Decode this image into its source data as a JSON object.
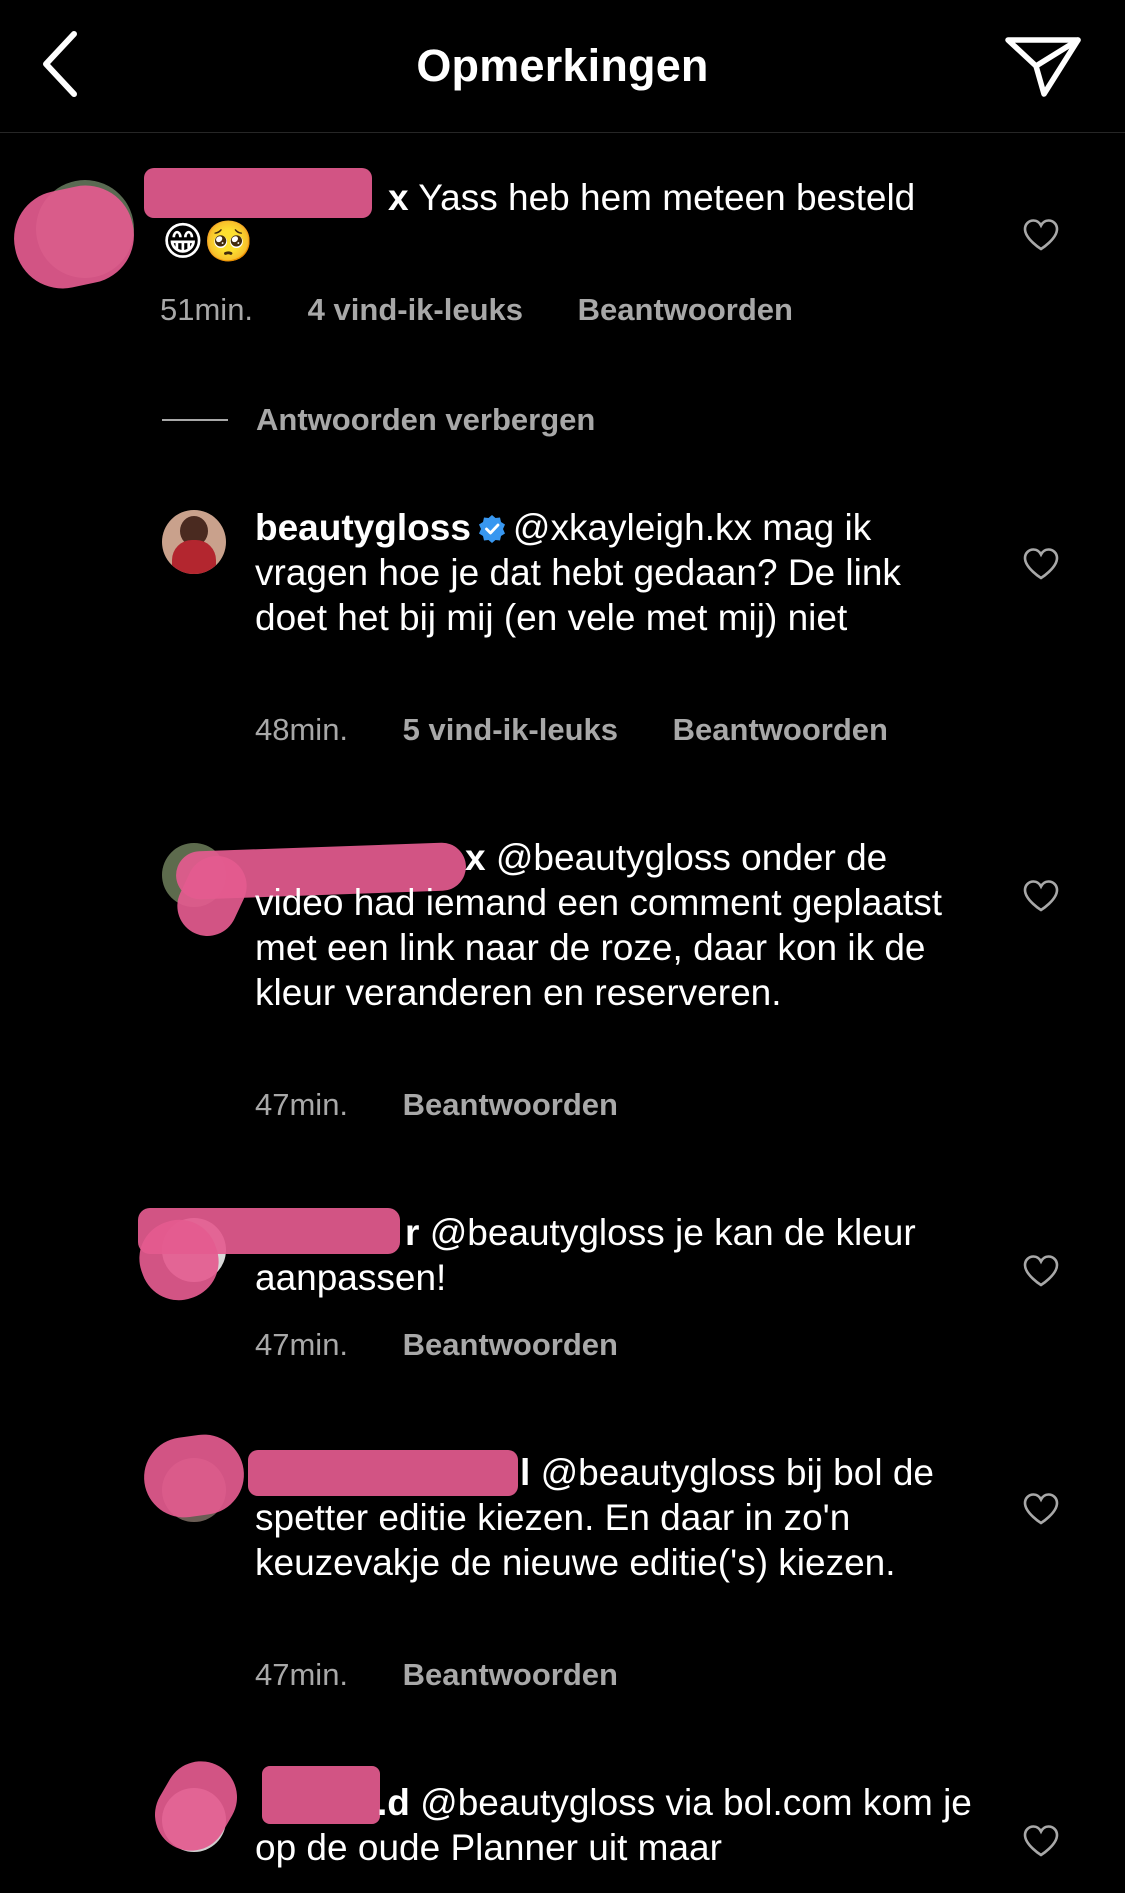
{
  "header": {
    "title": "Opmerkingen",
    "back_icon": "chevron-left-icon",
    "send_icon": "paper-plane-icon"
  },
  "comments": [
    {
      "username": "x",
      "text": "Yass heb hem meteen besteld",
      "emojis": "😁🥺",
      "time": "51min.",
      "likes": "4 vind-ik-leuks",
      "reply": "Beantwoorden"
    },
    {
      "username": "beautygloss",
      "verified": true,
      "mention": "@xkayleigh.kx",
      "text": "mag ik vragen hoe je dat hebt gedaan? De link doet het bij mij (en vele met mij) niet",
      "time": "48min.",
      "likes": "5 vind-ik-leuks",
      "reply": "Beantwoorden"
    },
    {
      "username": "x",
      "mention": "@beautygloss",
      "text": "onder de video had iemand een comment geplaatst met een link naar de roze, daar kon ik de kleur veranderen en reserveren.",
      "time": "47min.",
      "reply": "Beantwoorden"
    },
    {
      "username": "r",
      "mention": "@beautygloss",
      "text": "je kan de kleur aanpassen!",
      "time": "47min.",
      "reply": "Beantwoorden"
    },
    {
      "username": "l",
      "mention": "@beautygloss",
      "text": "bij bol de spetter editie kiezen. En daar in zo'n keuzevakje de nieuwe editie('s) kiezen.",
      "time": "47min.",
      "reply": "Beantwoorden"
    },
    {
      "username": ".d",
      "mention": "@beautygloss",
      "text": "via bol.com kom je op de oude Planner uit maar"
    }
  ],
  "hide_replies": "Antwoorden verbergen",
  "colors": {
    "background": "#000000",
    "secondary_text": "#a8a8a8",
    "verified": "#3897f0",
    "redaction": "#e45b8f"
  }
}
